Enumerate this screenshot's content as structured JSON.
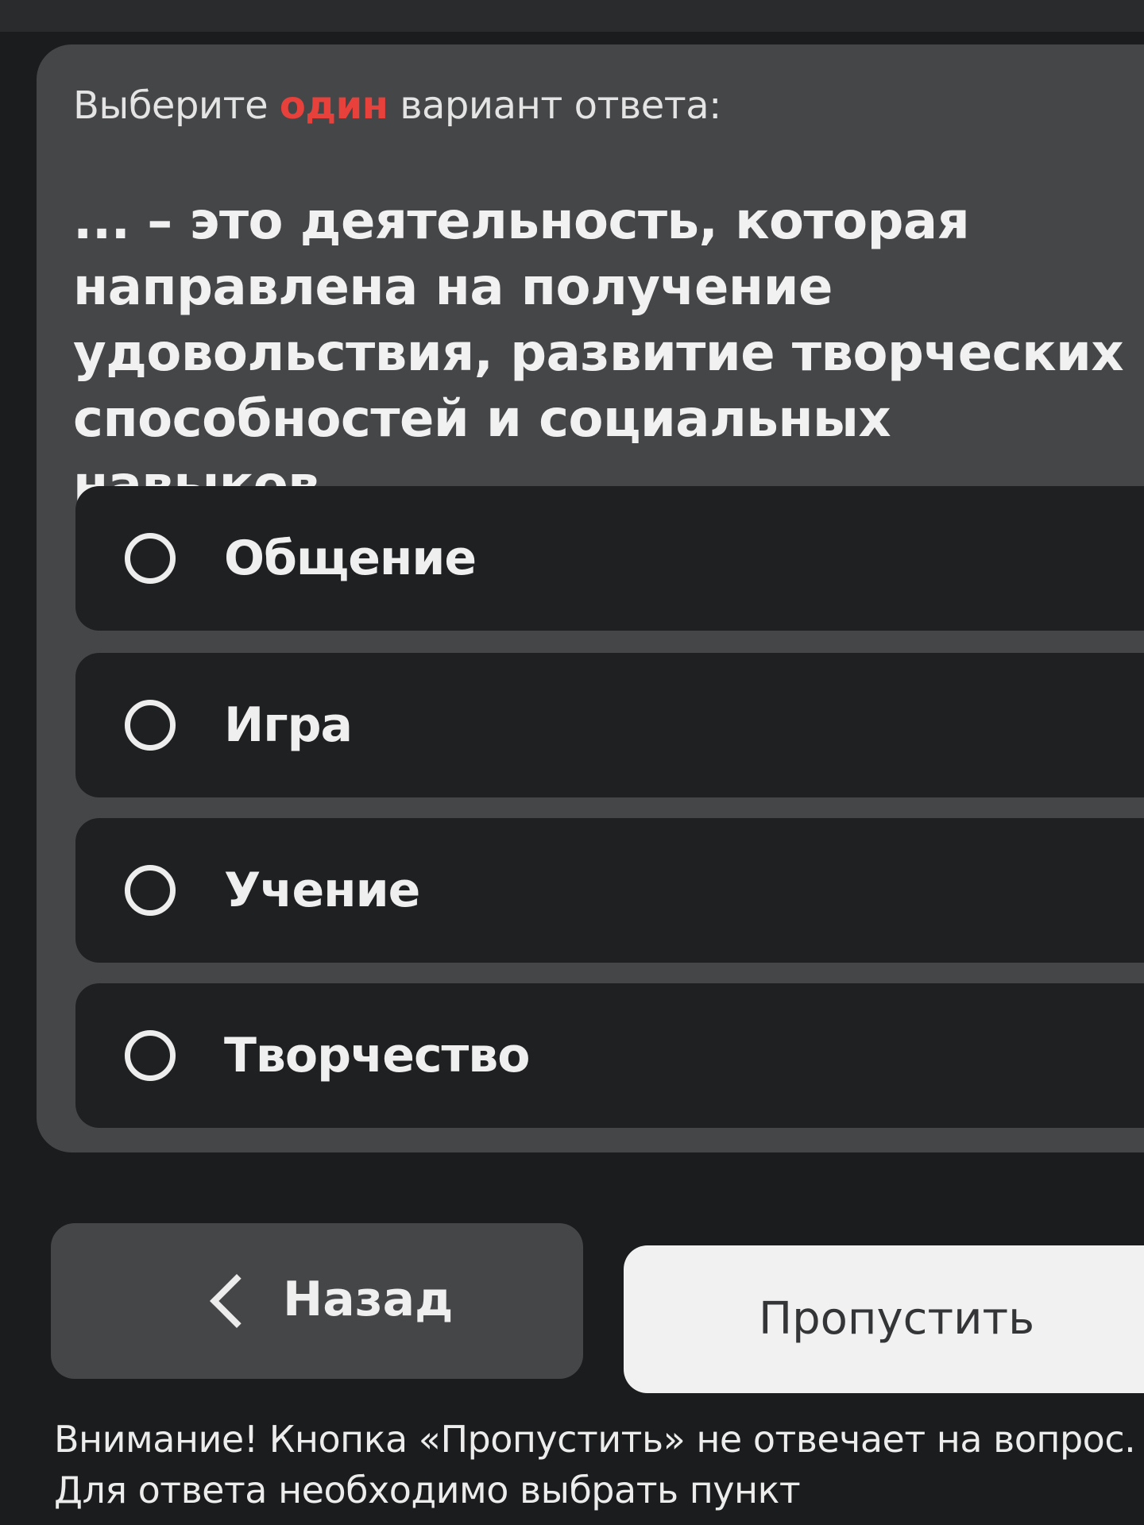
{
  "instruction": {
    "prefix": "Выберите",
    "accent": "один",
    "suffix": "вариант ответа:",
    "accent_color": "#e8403a"
  },
  "question": {
    "text": "... – это деятельность, которая направлена на получение удовольствия, развитие творческих способностей и социальных навыков"
  },
  "options": [
    {
      "label": "Общение",
      "selected": false
    },
    {
      "label": "Игра",
      "selected": false
    },
    {
      "label": "Учение",
      "selected": false
    },
    {
      "label": "Творчество",
      "selected": false
    }
  ],
  "navigation": {
    "back_label": "Назад",
    "skip_label": "Пропустить"
  },
  "warning": {
    "text": "Внимание! Кнопка «Пропустить» не отвечает на вопрос. Для ответа необходимо выбрать пункт"
  },
  "icons": {
    "back": "chevron-left-icon",
    "option": "radio-empty-icon"
  }
}
